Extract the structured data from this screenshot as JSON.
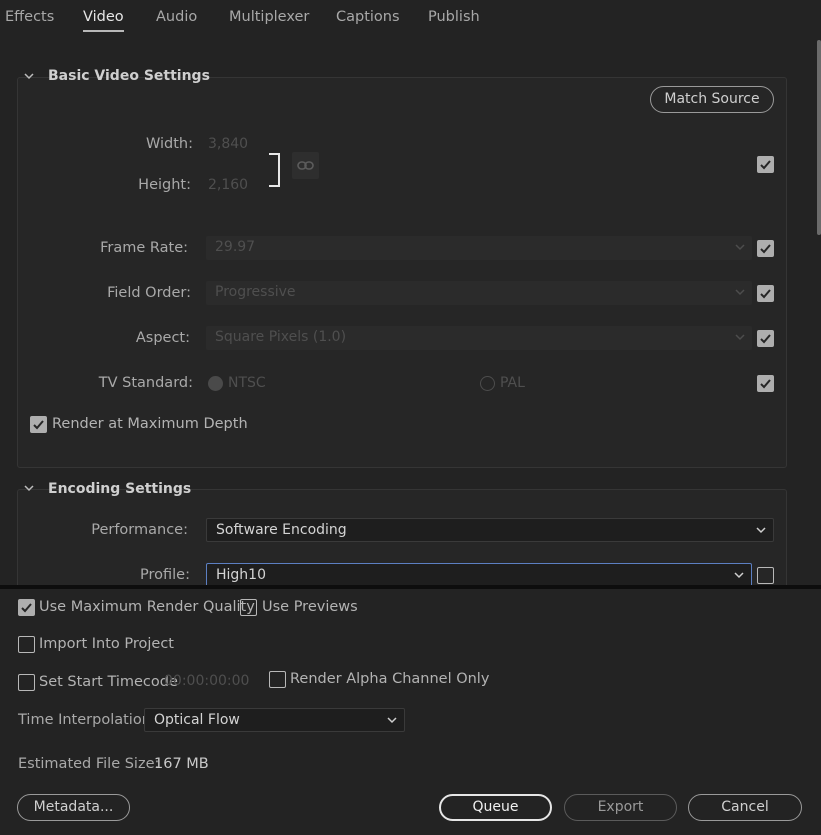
{
  "tabs": [
    {
      "label": "Effects",
      "active": false
    },
    {
      "label": "Video",
      "active": true
    },
    {
      "label": "Audio",
      "active": false
    },
    {
      "label": "Multiplexer",
      "active": false
    },
    {
      "label": "Captions",
      "active": false
    },
    {
      "label": "Publish",
      "active": false
    }
  ],
  "basic": {
    "title": "Basic Video Settings",
    "match_source": "Match Source",
    "width_label": "Width:",
    "width_value": "3,840",
    "height_label": "Height:",
    "height_value": "2,160",
    "frame_rate_label": "Frame Rate:",
    "frame_rate_value": "29.97",
    "field_order_label": "Field Order:",
    "field_order_value": "Progressive",
    "aspect_label": "Aspect:",
    "aspect_value": "Square Pixels (1.0)",
    "tv_standard_label": "TV Standard:",
    "ntsc_label": "NTSC",
    "pal_label": "PAL",
    "render_max_depth_label": "Render at Maximum Depth"
  },
  "encoding": {
    "title": "Encoding Settings",
    "performance_label": "Performance:",
    "performance_value": "Software Encoding",
    "profile_label": "Profile:",
    "profile_value": "High10"
  },
  "bottom": {
    "use_max_render_quality": "Use Maximum Render Quality",
    "use_previews": "Use Previews",
    "import_into_project": "Import Into Project",
    "set_start_timecode": "Set Start Timecode",
    "timecode_value": "00:00:00:00",
    "render_alpha_only": "Render Alpha Channel Only",
    "time_interpolation_label": "Time Interpolation:",
    "time_interpolation_value": "Optical Flow",
    "estimated_file_size_label": "Estimated File Size:",
    "estimated_file_size_value": "167 MB",
    "metadata_button": "Metadata...",
    "queue_button": "Queue",
    "export_button": "Export",
    "cancel_button": "Cancel"
  },
  "colors": {
    "background": "#232323",
    "focus_border": "#5c7fc2",
    "checkbox_fill": "#aeaeae"
  }
}
